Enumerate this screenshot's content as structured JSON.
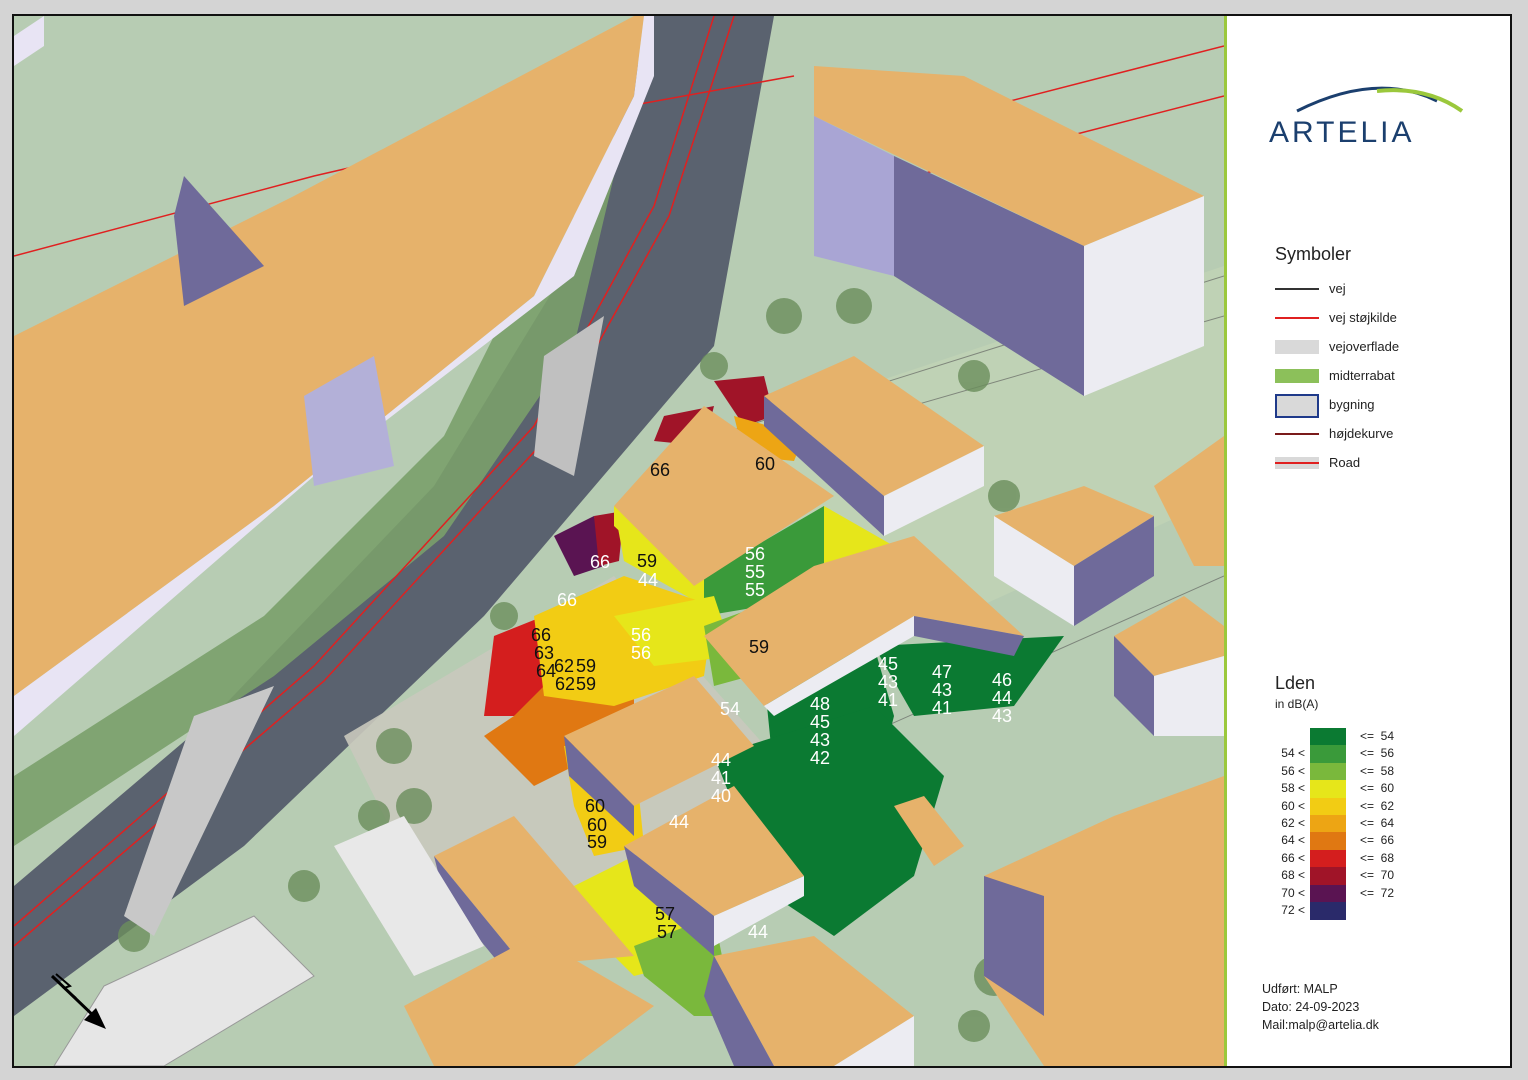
{
  "brand": {
    "name": "ARTELIA",
    "primary_color": "#1b3f6e",
    "accent_color": "#9bc83c"
  },
  "symbols": {
    "title": "Symboler",
    "items": [
      {
        "label": "vej",
        "style": "line",
        "color": "#333333"
      },
      {
        "label": "vej støjkilde",
        "style": "line",
        "color": "#e02020"
      },
      {
        "label": "vejoverflade",
        "style": "fill",
        "color": "#d9d9d9"
      },
      {
        "label": "midterrabat",
        "style": "fill",
        "color": "#8cc05a"
      },
      {
        "label": "bygning",
        "style": "box",
        "color": "#d9d9d9",
        "border": "#1f3a8a"
      },
      {
        "label": "højdekurve",
        "style": "line",
        "color": "#7a1a1a"
      },
      {
        "label": "Road",
        "style": "double-line",
        "color": "#e02020"
      }
    ]
  },
  "noise_legend": {
    "title": "Lden",
    "unit": "in dB(A)",
    "classes": [
      {
        "lower": "",
        "upper": "<=  54",
        "color": "#0b7a32"
      },
      {
        "lower": "54 <",
        "upper": "<=  56",
        "color": "#3a9a3a"
      },
      {
        "lower": "56 <",
        "upper": "<=  58",
        "color": "#7ab83c"
      },
      {
        "lower": "58 <",
        "upper": "<=  60",
        "color": "#e6e61a"
      },
      {
        "lower": "60 <",
        "upper": "<=  62",
        "color": "#f2cc14"
      },
      {
        "lower": "62 <",
        "upper": "<=  64",
        "color": "#eda514"
      },
      {
        "lower": "64 <",
        "upper": "<=  66",
        "color": "#e07812"
      },
      {
        "lower": "66 <",
        "upper": "<=  68",
        "color": "#d41e1e"
      },
      {
        "lower": "68 <",
        "upper": "<=  70",
        "color": "#a01428"
      },
      {
        "lower": "70 <",
        "upper": "<=  72",
        "color": "#5a1452"
      },
      {
        "lower": "72 <",
        "upper": "",
        "color": "#2a2a6a"
      }
    ]
  },
  "footer": {
    "performed_by": "Udført: MALP",
    "date": "Dato: 24-09-2023",
    "mail": "Mail:malp@artelia.dk"
  },
  "map_labels": [
    {
      "text": "66",
      "color": "#111111"
    },
    {
      "text": "60",
      "color": "#111111"
    },
    {
      "text": "66",
      "color": "#ffffff"
    },
    {
      "text": "59",
      "color": "#111111"
    },
    {
      "text": "44",
      "color": "#ffffff"
    },
    {
      "text": "56",
      "color": "#ffffff"
    },
    {
      "text": "55",
      "color": "#ffffff"
    },
    {
      "text": "55",
      "color": "#ffffff"
    },
    {
      "text": "66",
      "color": "#ffffff"
    },
    {
      "text": "66",
      "color": "#111111"
    },
    {
      "text": "63",
      "color": "#111111"
    },
    {
      "text": "64",
      "color": "#111111"
    },
    {
      "text": "62",
      "color": "#111111"
    },
    {
      "text": "59",
      "color": "#111111"
    },
    {
      "text": "62",
      "color": "#111111"
    },
    {
      "text": "59",
      "color": "#111111"
    },
    {
      "text": "56",
      "color": "#ffffff"
    },
    {
      "text": "56",
      "color": "#ffffff"
    },
    {
      "text": "59",
      "color": "#111111"
    },
    {
      "text": "54",
      "color": "#ffffff"
    },
    {
      "text": "45",
      "color": "#ffffff"
    },
    {
      "text": "43",
      "color": "#ffffff"
    },
    {
      "text": "41",
      "color": "#ffffff"
    },
    {
      "text": "47",
      "color": "#ffffff"
    },
    {
      "text": "43",
      "color": "#ffffff"
    },
    {
      "text": "41",
      "color": "#ffffff"
    },
    {
      "text": "46",
      "color": "#ffffff"
    },
    {
      "text": "44",
      "color": "#ffffff"
    },
    {
      "text": "43",
      "color": "#ffffff"
    },
    {
      "text": "48",
      "color": "#ffffff"
    },
    {
      "text": "45",
      "color": "#ffffff"
    },
    {
      "text": "43",
      "color": "#ffffff"
    },
    {
      "text": "42",
      "color": "#ffffff"
    },
    {
      "text": "44",
      "color": "#ffffff"
    },
    {
      "text": "41",
      "color": "#ffffff"
    },
    {
      "text": "40",
      "color": "#ffffff"
    },
    {
      "text": "60",
      "color": "#111111"
    },
    {
      "text": "60",
      "color": "#111111"
    },
    {
      "text": "59",
      "color": "#111111"
    },
    {
      "text": "44",
      "color": "#ffffff"
    },
    {
      "text": "57",
      "color": "#111111"
    },
    {
      "text": "57",
      "color": "#111111"
    },
    {
      "text": "44",
      "color": "#ffffff"
    }
  ],
  "north_arrow": {
    "icon": "north-arrow-icon"
  }
}
